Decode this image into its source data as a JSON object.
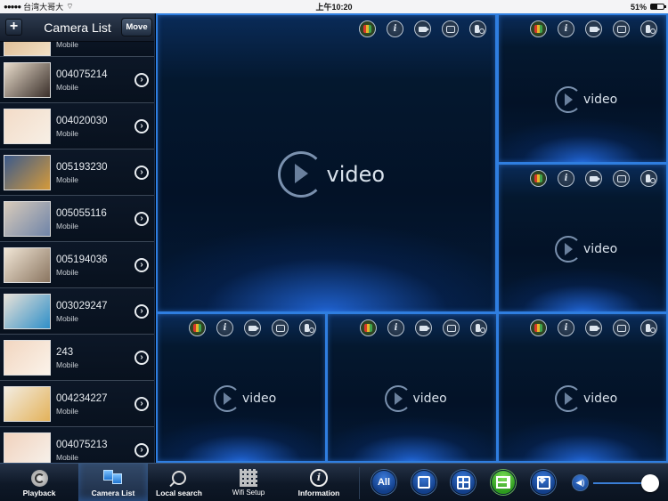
{
  "status_bar": {
    "carrier": "台湾大哥大",
    "signal_dots": "●●●●●",
    "time": "上午10:20",
    "battery": "51%",
    "battery_level": 0.51
  },
  "sidebar": {
    "title": "Camera List",
    "add_label": "+",
    "move_label": "Move",
    "cameras": [
      {
        "id": "",
        "type": "Mobile",
        "thumb": [
          "#d9b58a",
          "#f2e0c4"
        ]
      },
      {
        "id": "004075214",
        "type": "Mobile",
        "thumb": [
          "#e8dccb",
          "#3a2f2a"
        ]
      },
      {
        "id": "004020030",
        "type": "Mobile",
        "thumb": [
          "#f3dcc8",
          "#f7efe5"
        ]
      },
      {
        "id": "005193230",
        "type": "Mobile",
        "thumb": [
          "#3b5a8c",
          "#d59a3a"
        ]
      },
      {
        "id": "005055116",
        "type": "Mobile",
        "thumb": [
          "#d8cbbb",
          "#6f84a8"
        ]
      },
      {
        "id": "005194036",
        "type": "Mobile",
        "thumb": [
          "#f1e6d6",
          "#8a7560"
        ]
      },
      {
        "id": "003029247",
        "type": "Mobile",
        "thumb": [
          "#e7e1d8",
          "#2f8fc8"
        ]
      },
      {
        "id": "243",
        "type": "Mobile",
        "thumb": [
          "#f2d6c0",
          "#fbf3ea"
        ]
      },
      {
        "id": "004234227",
        "type": "Mobile",
        "thumb": [
          "#f3ede2",
          "#e3b25a"
        ]
      },
      {
        "id": "004075213",
        "type": "Mobile",
        "thumb": [
          "#f1d2bd",
          "#f7f2ec"
        ]
      }
    ],
    "chevron_glyph": "›"
  },
  "video_tiles": {
    "placeholder_text": "video",
    "icons": [
      "ptz-icon",
      "info-icon",
      "record-icon",
      "snapshot-icon",
      "talk-icon"
    ],
    "info_glyph": "i",
    "count": 6
  },
  "toolbar": {
    "tabs": [
      {
        "label": "Playback",
        "icon": "playback-icon"
      },
      {
        "label": "Camera List",
        "icon": "camera-list-icon",
        "active": true
      },
      {
        "label": "Local search",
        "icon": "search-icon"
      },
      {
        "label": "Wifi Setup",
        "icon": "qr-code-icon"
      },
      {
        "label": "Information",
        "icon": "info-icon"
      }
    ],
    "info_glyph": "i",
    "layouts": [
      {
        "label": "All",
        "name": "layout-all"
      },
      {
        "label": "",
        "name": "layout-single"
      },
      {
        "label": "",
        "name": "layout-quad"
      },
      {
        "label": "",
        "name": "layout-six",
        "active": true
      },
      {
        "label": "",
        "name": "layout-fullscreen"
      }
    ],
    "volume_glyph": "◀)",
    "volume_level": 1.0
  },
  "colors": {
    "accent_blue": "#2f7ee0",
    "active_layout_green": "#3fae2a",
    "panel_dark": "#0a1422"
  }
}
